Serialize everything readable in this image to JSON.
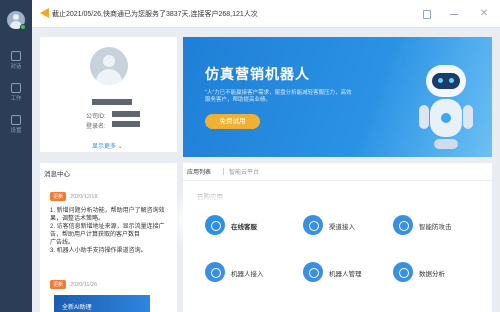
{
  "sidebar": {
    "items": [
      {
        "label": "对话",
        "icon": "chat-icon"
      },
      {
        "label": "工作",
        "icon": "work-icon"
      },
      {
        "label": "设置",
        "icon": "settings-icon"
      }
    ]
  },
  "titlebar": {
    "notice": "截止2021/05/26,快商通已为您服务了3837天,连接客户268,121人次"
  },
  "profile": {
    "company_label": "公司ID:",
    "login_label": "登录名:",
    "show_more": "显示更多 ⌄"
  },
  "banner": {
    "title": "仿真营销机器人",
    "subtitle": "“人”力已不能赢接客户需求，尾盘分析能减轻客服压力，高效服务客户，帮助提高业绩。",
    "trial_button": "免费试用"
  },
  "messages": {
    "title": "消息中心",
    "items": [
      {
        "badge": "更新",
        "date": "2020/12/18",
        "lines": [
          "1. 新增问题分析功能，帮助用户了解咨询效果，调整话术策略。",
          "2. 访客信息新增地址来源，显示流量连接广告，帮助用户计算获取的客户数目",
          "广告线。",
          "3. 机器人小助手支持操作渠道咨询。"
        ]
      },
      {
        "badge": "更新",
        "date": "2020/11/26",
        "lines": []
      }
    ],
    "thumb_text": "全新AI助理"
  },
  "apps": {
    "tabs": [
      {
        "label": "应用列表",
        "active": true
      },
      {
        "label": "智能云平台",
        "active": false
      }
    ],
    "purchased_title": "已购应用",
    "tiles": [
      {
        "label": "在线客服",
        "icon": "online-service-icon",
        "color": "#2f8fe6"
      },
      {
        "label": "渠道接入",
        "icon": "channel-access-icon",
        "color": "#3a8fe0"
      },
      {
        "label": "智能防攻击",
        "icon": "anti-attack-icon",
        "color": "#3a8fe0"
      },
      {
        "label": "机器人接入",
        "icon": "robot-access-icon",
        "color": "#3a8fe0"
      },
      {
        "label": "机器人管理",
        "icon": "robot-manage-icon",
        "color": "#3a8fe0"
      },
      {
        "label": "数据分析",
        "icon": "data-analysis-icon",
        "color": "#3a8fe0"
      }
    ]
  }
}
